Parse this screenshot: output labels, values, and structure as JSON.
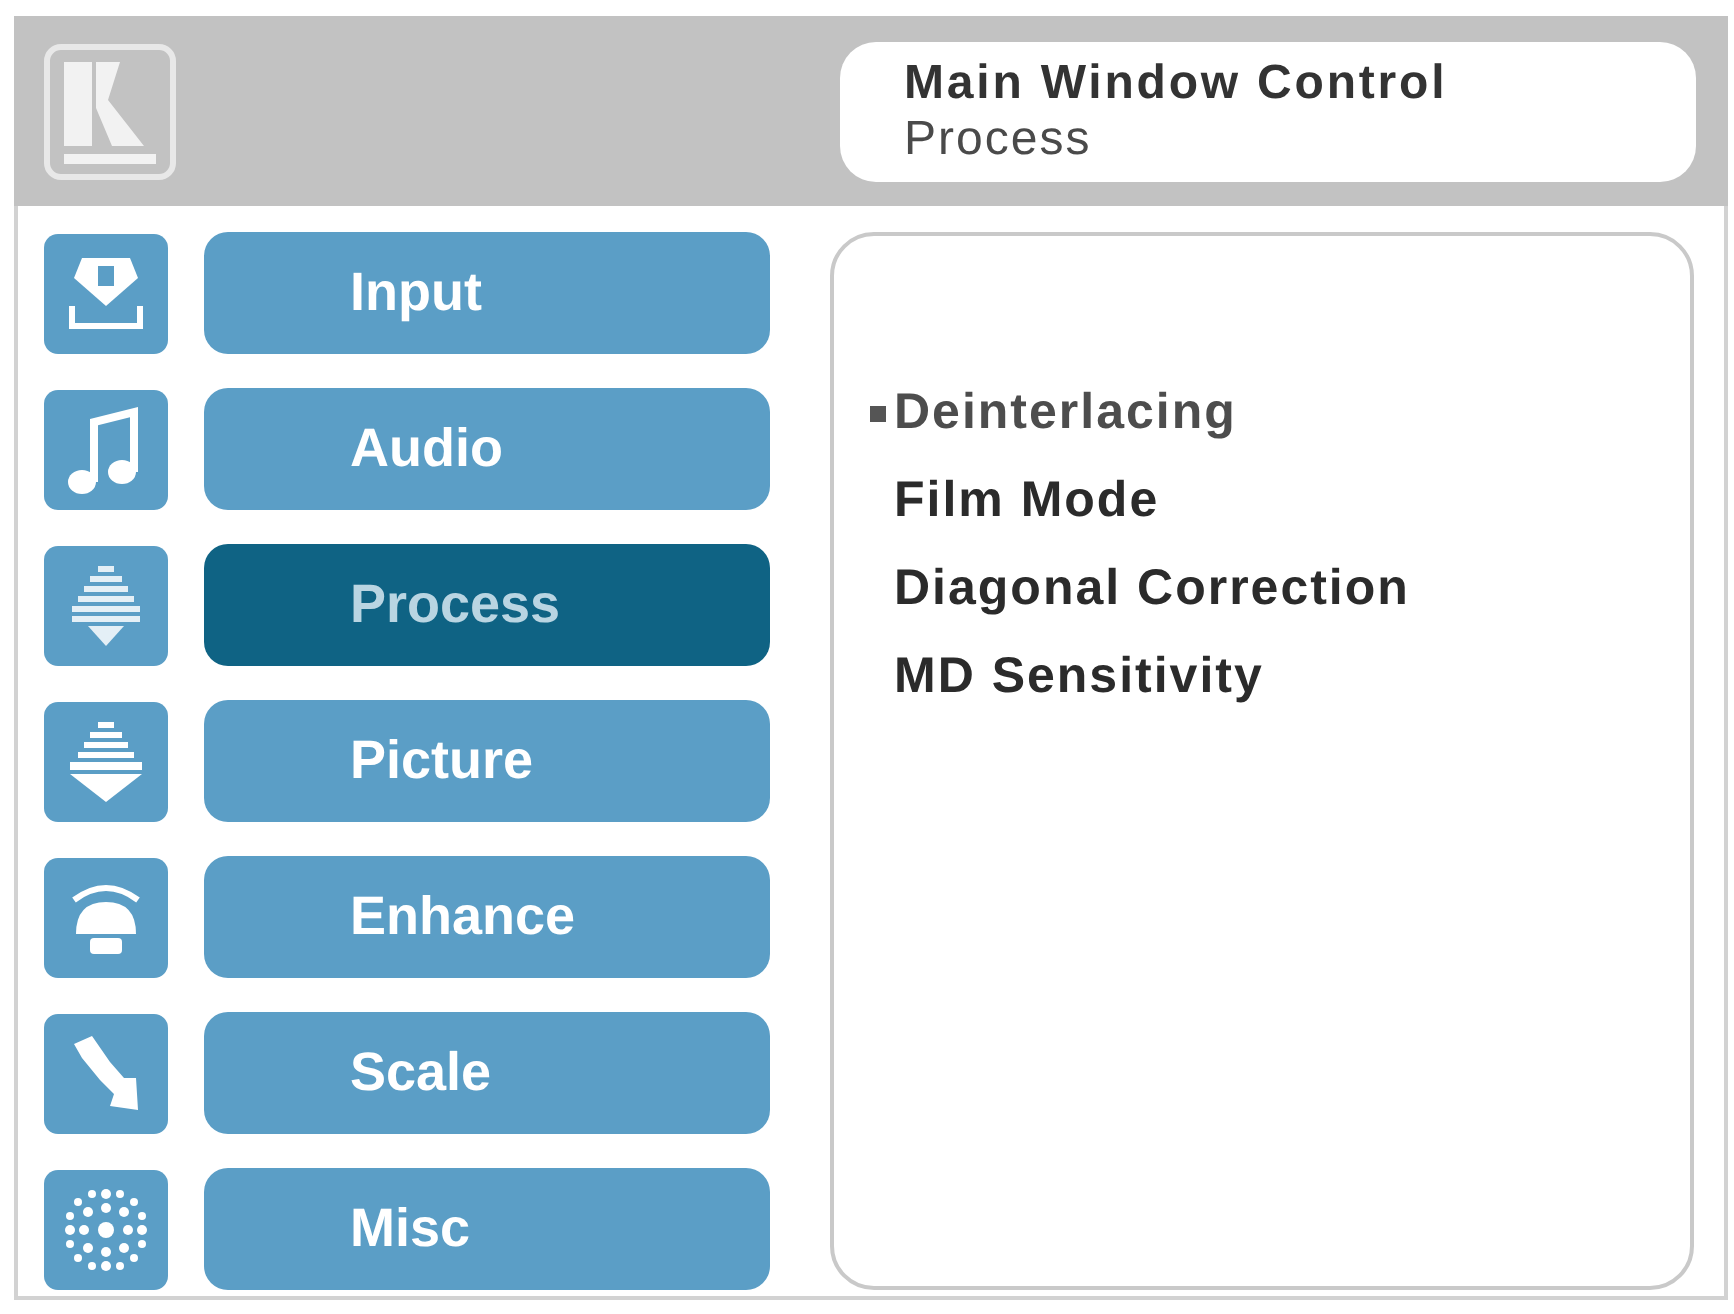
{
  "header": {
    "title": "Main Window Control",
    "subtitle": "Process"
  },
  "sidebar": {
    "items": [
      {
        "label": "Input",
        "selected": false
      },
      {
        "label": "Audio",
        "selected": false
      },
      {
        "label": "Process",
        "selected": true
      },
      {
        "label": "Picture",
        "selected": false
      },
      {
        "label": "Enhance",
        "selected": false
      },
      {
        "label": "Scale",
        "selected": false
      },
      {
        "label": "Misc",
        "selected": false
      }
    ]
  },
  "menu": {
    "items": [
      {
        "label": "Deinterlacing",
        "selected": true
      },
      {
        "label": "Film Mode",
        "selected": false
      },
      {
        "label": "Diagonal Correction",
        "selected": false
      },
      {
        "label": "MD Sensitivity",
        "selected": false
      }
    ]
  }
}
